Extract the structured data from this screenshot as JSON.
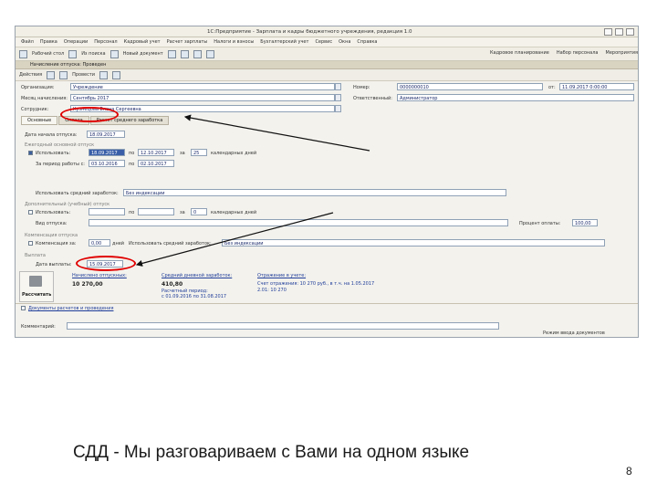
{
  "window": {
    "title": "1С:Предприятие - Зарплата и кадры бюджетного учреждения, редакция 1.0"
  },
  "menu": [
    "Файл",
    "Правка",
    "Операции",
    "Персонал",
    "Кадровый учет",
    "Расчет зарплаты",
    "Налоги и взносы",
    "Бухгалтерский учет",
    "Сервис",
    "Окна",
    "Справка"
  ],
  "toolbar": {
    "items": [
      "Рабочий стол",
      "Из поиска",
      "Новый документ"
    ],
    "right": [
      "Кадровое планирование",
      "Набор персонала",
      "Мероприятия"
    ]
  },
  "panel": {
    "title": "Начисление отпуска: Проведен"
  },
  "actions": {
    "act": "Действия",
    "post": "Провести"
  },
  "form": {
    "org_label": "Организация:",
    "org_value": "Учреждение",
    "month_label": "Месяц начисления:",
    "month_value": "Сентябрь 2017",
    "emp_label": "Сотрудник:",
    "emp_value": "Кузнецова Елена Сергеевна",
    "num_label": "Номер:",
    "num_value": "0000000010",
    "date_label": "от:",
    "date_value": "11.09.2017 0:00:00",
    "resp_label": "Ответственный:",
    "resp_value": "Администратор"
  },
  "tabs": [
    "Основные",
    "Оплата",
    "Расчет среднего заработка"
  ],
  "vacation": {
    "start_label": "Дата начала отпуска:",
    "start_value": "18.09.2017",
    "group1": "Ежегодный основной отпуск",
    "taken_label": "Использовать:",
    "from": "18.09.2017",
    "to_label": "по",
    "to": "12.10.2017",
    "days_label": "за",
    "days": "25",
    "days_unit": "календарных дней",
    "period_label": "За период работы с:",
    "period_from": "03.10.2016",
    "period_to": "02.10.2017",
    "avg_label": "Использовать средний заработок:",
    "avg_value": "Без индексации",
    "group2": "Дополнительный (учебный) отпуск",
    "extra_label": "Использовать:",
    "extra_days": "0",
    "extra_unit": "календарных дней",
    "kind_label": "Вид отпуска:",
    "bonus_label": "Процент оплаты:",
    "bonus_value": "100,00",
    "group3": "Компенсация отпуска",
    "comp_label": "Компенсация за:",
    "comp_days": "0,00",
    "comp_unit": "дней",
    "comp_avg_label": "Использовать средний заработок:",
    "comp_avg": "Без индексации",
    "group4": "Выплата",
    "pay_label": "Дата выплаты:",
    "pay_value": "15.09.2017"
  },
  "totals": {
    "calc_label": "Рассчитать",
    "accrued_label": "Начислено отпускных:",
    "accrued_value": "10 270,00",
    "avg_label": "Средний дневной заработок:",
    "avg_value": "410,80",
    "avg_note": "Расчетный период:",
    "avg_period": "с 01.09.2016 по 31.08.2017",
    "display_label": "Отражение в учете:",
    "display_value": "Счет отражения: 10 270 руб., в т.ч. на 1.05.2017",
    "display_value2": "2.01: 10 270"
  },
  "footer": {
    "docs_label": "Документы расчетов и проведения",
    "comment_label": "Комментарий:",
    "status_label": "Режим ввода документов"
  },
  "caption": "СДД - Мы разговариваем с Вами на одном языке",
  "page_number": "8",
  "colors": {
    "highlight": "#e00000",
    "arrow": "#111111",
    "link": "#1f3d99"
  }
}
